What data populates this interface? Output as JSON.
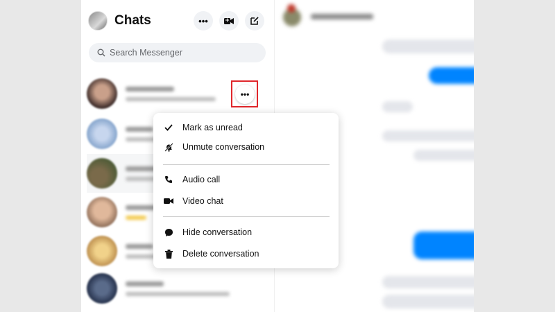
{
  "sidebar": {
    "title": "Chats",
    "search_placeholder": "Search Messenger"
  },
  "header_icons": [
    "more-icon",
    "video-camera-icon",
    "compose-icon"
  ],
  "context_menu": {
    "items": [
      {
        "label": "Mark as unread",
        "icon": "checkmark-icon"
      },
      {
        "label": "Unmute conversation",
        "icon": "bell-muted-icon"
      },
      {
        "label": "Audio call",
        "icon": "phone-icon"
      },
      {
        "label": "Video chat",
        "icon": "video-camera-icon"
      },
      {
        "label": "Hide conversation",
        "icon": "speech-bubble-icon"
      },
      {
        "label": "Delete conversation",
        "icon": "trash-icon"
      }
    ]
  },
  "colors": {
    "accent": "#0084ff",
    "highlight": "#e0262b",
    "search_bg": "#f0f2f5"
  }
}
